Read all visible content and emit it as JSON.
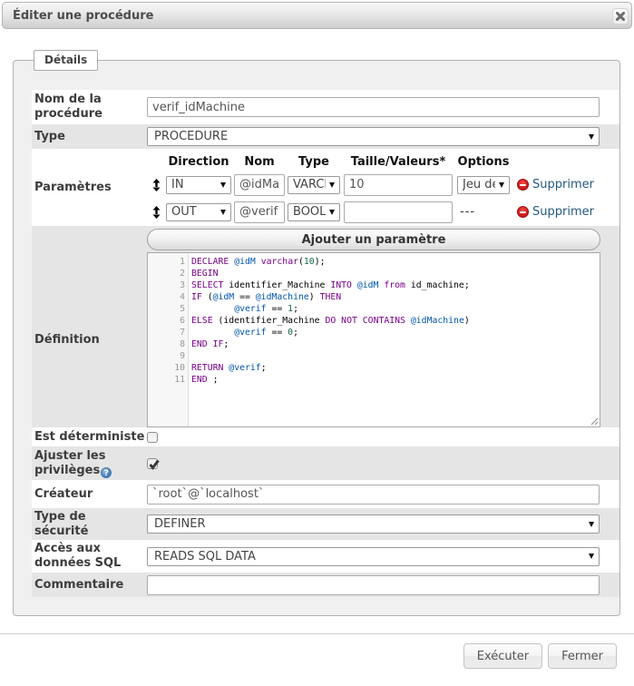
{
  "dialog": {
    "title": "Éditer une procédure"
  },
  "tab_label": "Détails",
  "form": {
    "name": {
      "label": "Nom de la\nprocédure",
      "value": "verif_idMachine"
    },
    "type": {
      "label": "Type",
      "value": "PROCEDURE"
    },
    "parameters": {
      "label": "Paramètres",
      "headers": {
        "direction": "Direction",
        "name": "Nom",
        "type": "Type",
        "length": "Taille/Valeurs*",
        "options": "Options"
      },
      "rows": [
        {
          "direction": "IN",
          "name": "@idMachine",
          "type": "VARCHAR",
          "length": "10",
          "options": "Jeu de caractères",
          "remove_label": "Supprimer"
        },
        {
          "direction": "OUT",
          "name": "@verif",
          "type": "BOOLEAN",
          "length": "",
          "options": "---",
          "remove_label": "Supprimer"
        }
      ],
      "add_button": "Ajouter un paramètre"
    },
    "definition": {
      "label": "Définition"
    },
    "deterministic": {
      "label": "Est déterministe",
      "checked": false
    },
    "privileges": {
      "label": "Ajuster les\nprivilèges",
      "checked": true,
      "help_icon": "?"
    },
    "creator": {
      "label": "Créateur",
      "value": "`root`@`localhost`"
    },
    "security_type": {
      "label": "Type de\nsécurité",
      "value": "DEFINER"
    },
    "sql_access": {
      "label": "Accès aux\ndonnées SQL",
      "value": "READS SQL DATA"
    },
    "comment": {
      "label": "Commentaire",
      "value": ""
    }
  },
  "editor": {
    "lines": [
      [
        [
          "k",
          "DECLARE"
        ],
        [
          "p",
          " "
        ],
        [
          "v",
          "@idM"
        ],
        [
          "p",
          " "
        ],
        [
          "k",
          "varchar"
        ],
        [
          "p",
          "("
        ],
        [
          "n",
          "10"
        ],
        [
          "p",
          ");"
        ]
      ],
      [
        [
          "k",
          "BEGIN"
        ]
      ],
      [
        [
          "k",
          "SELECT"
        ],
        [
          "p",
          " identifier_Machine "
        ],
        [
          "k",
          "INTO"
        ],
        [
          "p",
          " "
        ],
        [
          "v",
          "@idM"
        ],
        [
          "p",
          " "
        ],
        [
          "k",
          "from"
        ],
        [
          "p",
          " id_machine;"
        ]
      ],
      [
        [
          "k",
          "IF"
        ],
        [
          "p",
          " ("
        ],
        [
          "v",
          "@idM"
        ],
        [
          "p",
          " == "
        ],
        [
          "v",
          "@idMachine"
        ],
        [
          "p",
          ") "
        ],
        [
          "k",
          "THEN"
        ]
      ],
      [
        [
          "p",
          "        "
        ],
        [
          "v",
          "@verif"
        ],
        [
          "p",
          " == "
        ],
        [
          "n",
          "1"
        ],
        [
          "p",
          ";"
        ]
      ],
      [
        [
          "k",
          "ELSE"
        ],
        [
          "p",
          " (identifier_Machine "
        ],
        [
          "k",
          "DO"
        ],
        [
          "p",
          " "
        ],
        [
          "k",
          "NOT"
        ],
        [
          "p",
          " "
        ],
        [
          "k",
          "CONTAINS"
        ],
        [
          "p",
          " "
        ],
        [
          "v",
          "@idMachine"
        ],
        [
          "p",
          ")"
        ]
      ],
      [
        [
          "p",
          "        "
        ],
        [
          "v",
          "@verif"
        ],
        [
          "p",
          " == "
        ],
        [
          "n",
          "0"
        ],
        [
          "p",
          ";"
        ]
      ],
      [
        [
          "k",
          "END"
        ],
        [
          "p",
          " "
        ],
        [
          "k",
          "IF"
        ],
        [
          "p",
          ";"
        ]
      ],
      [],
      [
        [
          "k",
          "RETURN"
        ],
        [
          "p",
          " "
        ],
        [
          "v",
          "@verif"
        ],
        [
          "p",
          ";"
        ]
      ],
      [
        [
          "k",
          "END"
        ],
        [
          "p",
          " ;"
        ]
      ]
    ]
  },
  "footer": {
    "execute_label": "Exécuter",
    "close_label": "Fermer"
  }
}
